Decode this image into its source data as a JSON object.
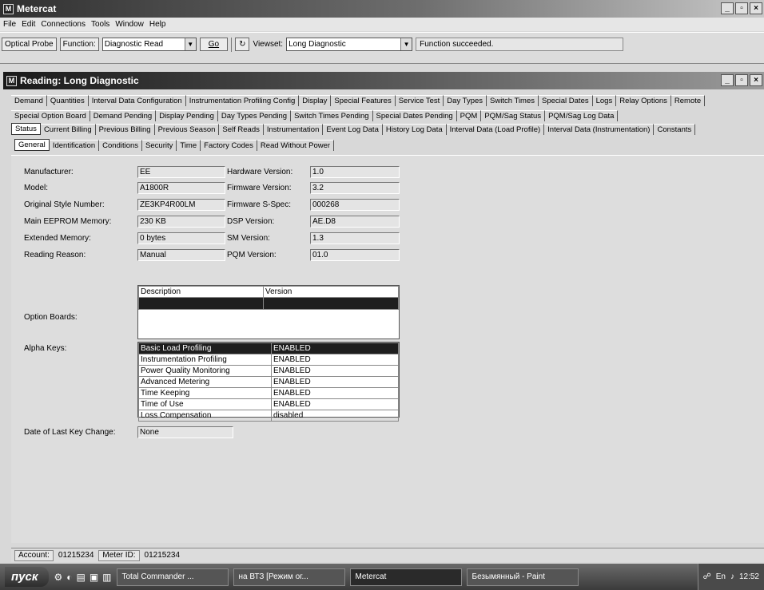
{
  "app": {
    "title": "Metercat"
  },
  "menu": [
    "File",
    "Edit",
    "Connections",
    "Tools",
    "Window",
    "Help"
  ],
  "toolbar": {
    "optical_probe": "Optical Probe",
    "function_label": "Function:",
    "function_value": "Diagnostic Read",
    "go": "Go",
    "viewset_label": "Viewset:",
    "viewset_value": "Long Diagnostic",
    "status": "Function succeeded."
  },
  "child": {
    "title": "Reading: Long Diagnostic"
  },
  "tabs_row1": [
    "Demand",
    "Quantities",
    "Interval Data Configuration",
    "Instrumentation Profiling Config",
    "Display",
    "Special Features",
    "Service Test",
    "Day Types",
    "Switch Times",
    "Special Dates",
    "Logs",
    "Relay Options",
    "Remote"
  ],
  "tabs_row2": [
    "Special Option Board",
    "Demand Pending",
    "Display Pending",
    "Day Types Pending",
    "Switch Times Pending",
    "Special Dates Pending",
    "PQM",
    "PQM/Sag Status",
    "PQM/Sag Log Data"
  ],
  "tabs_row3": [
    "Status",
    "Current Billing",
    "Previous Billing",
    "Previous Season",
    "Self Reads",
    "Instrumentation",
    "Event Log Data",
    "History Log Data",
    "Interval Data (Load Profile)",
    "Interval Data (Instrumentation)",
    "Constants"
  ],
  "tabs_row4": [
    "General",
    "Identification",
    "Conditions",
    "Security",
    "Time",
    "Factory Codes",
    "Read Without Power"
  ],
  "general": {
    "manufacturer_label": "Manufacturer:",
    "manufacturer": "EE",
    "model_label": "Model:",
    "model": "A1800R",
    "style_label": "Original Style Number:",
    "style": "ZE3KP4R00LM",
    "eeprom_label": "Main EEPROM Memory:",
    "eeprom": "230 KB",
    "ext_label": "Extended Memory:",
    "ext": "0 bytes",
    "reason_label": "Reading Reason:",
    "reason": "Manual",
    "hw_label": "Hardware Version:",
    "hw": "1.0",
    "fw_label": "Firmware Version:",
    "fw": "3.2",
    "fwspec_label": "Firmware S-Spec:",
    "fwspec": "000268",
    "dsp_label": "DSP Version:",
    "dsp": "AE.D8",
    "sm_label": "SM Version:",
    "sm": "1.3",
    "pqm_label": "PQM Version:",
    "pqm": "01.0",
    "option_boards_label": "Option Boards:",
    "option_cols": [
      "Description",
      "Version"
    ],
    "alpha_label": "Alpha Keys:",
    "alpha_keys": [
      [
        "Basic Load Profiling",
        "ENABLED"
      ],
      [
        "Instrumentation Profiling",
        "ENABLED"
      ],
      [
        "Power Quality Monitoring",
        "ENABLED"
      ],
      [
        "Advanced Metering",
        "ENABLED"
      ],
      [
        "Time Keeping",
        "ENABLED"
      ],
      [
        "Time of Use",
        "ENABLED"
      ],
      [
        "Loss Compensation",
        "disabled"
      ]
    ],
    "last_key_label": "Date of Last Key Change:",
    "last_key": "None"
  },
  "status": {
    "account_label": "Account:",
    "account": "01215234",
    "meter_label": "Meter ID:",
    "meter": "01215234"
  },
  "taskbar": {
    "start": "пуск",
    "tasks": [
      "Total Commander ...",
      "на ВТЗ [Режим ог...",
      "Metercat",
      "Безымянный - Paint"
    ],
    "tray_lang": "En",
    "clock": "12:52"
  }
}
